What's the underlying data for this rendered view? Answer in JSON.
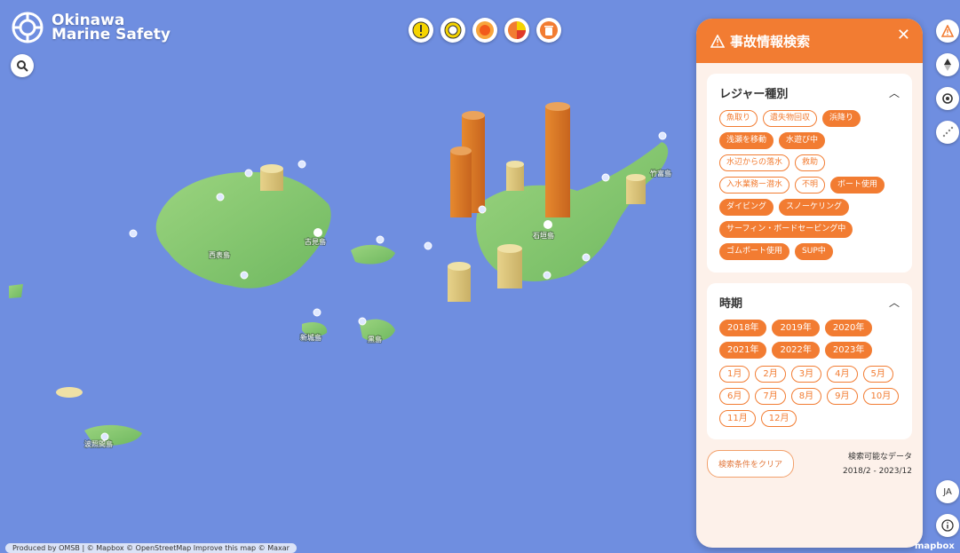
{
  "brand": {
    "line1": "Okinawa",
    "line2": "Marine Safety"
  },
  "map": {
    "labels": [
      "西表島",
      "古見島",
      "新城島",
      "黒島",
      "波照間島",
      "石垣島",
      "竹富島"
    ],
    "attribution": "Produced by OMSB | © Mapbox © OpenStreetMap Improve this map © Maxar",
    "mapbox": "mapbox"
  },
  "panel": {
    "title": "事故情報検索",
    "leisure": {
      "title": "レジャー種別",
      "chips": [
        {
          "label": "魚取り",
          "selected": false
        },
        {
          "label": "遺失物回収",
          "selected": false
        },
        {
          "label": "浜降り",
          "selected": true
        },
        {
          "label": "浅瀬を移動",
          "selected": true
        },
        {
          "label": "水遊び中",
          "selected": true
        },
        {
          "label": "水辺からの落水",
          "selected": false
        },
        {
          "label": "救助",
          "selected": false
        },
        {
          "label": "入水業務ー潜水",
          "selected": false
        },
        {
          "label": "不明",
          "selected": false
        },
        {
          "label": "ボート使用",
          "selected": true
        },
        {
          "label": "ダイビング",
          "selected": true
        },
        {
          "label": "スノーケリング",
          "selected": true
        },
        {
          "label": "サーフィン・ボードセービング中",
          "selected": true
        },
        {
          "label": "ゴムボート使用",
          "selected": true
        },
        {
          "label": "SUP中",
          "selected": true
        }
      ]
    },
    "period": {
      "title": "時期",
      "years": [
        {
          "label": "2018年",
          "selected": true
        },
        {
          "label": "2019年",
          "selected": true
        },
        {
          "label": "2020年",
          "selected": true
        },
        {
          "label": "2021年",
          "selected": true
        },
        {
          "label": "2022年",
          "selected": true
        },
        {
          "label": "2023年",
          "selected": true
        }
      ],
      "months": [
        {
          "label": "1月",
          "selected": false
        },
        {
          "label": "2月",
          "selected": false
        },
        {
          "label": "3月",
          "selected": false
        },
        {
          "label": "4月",
          "selected": false
        },
        {
          "label": "5月",
          "selected": false
        },
        {
          "label": "6月",
          "selected": false
        },
        {
          "label": "7月",
          "selected": false
        },
        {
          "label": "8月",
          "selected": false
        },
        {
          "label": "9月",
          "selected": false
        },
        {
          "label": "10月",
          "selected": false
        },
        {
          "label": "11月",
          "selected": false
        },
        {
          "label": "12月",
          "selected": false
        }
      ]
    },
    "clear_label": "検索条件をクリア",
    "range_label": "検索可能なデータ",
    "range_value": "2018/2 - 2023/12"
  },
  "lang": "JA",
  "colors": {
    "accent": "#f27c32",
    "sea": "#6f8ee0",
    "land": "#8fcf7a"
  }
}
